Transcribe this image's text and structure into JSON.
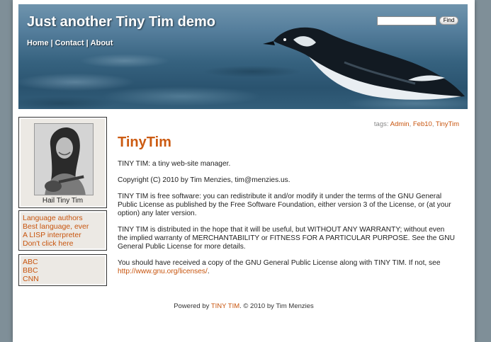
{
  "header": {
    "site_title": "Just another Tiny Tim demo",
    "nav": [
      "Home",
      "Contact",
      "About"
    ],
    "nav_separator": "|",
    "search_placeholder": "",
    "search_button": "Find"
  },
  "sidebar": {
    "photo_caption": "Hail Tiny Tim",
    "links_group1": [
      "Language authors",
      "Best language, ever",
      "A LISP interpreter",
      "Don't click here"
    ],
    "links_group2": [
      "ABC",
      "BBC",
      "CNN"
    ]
  },
  "post": {
    "tags_label": "tags:",
    "tags": [
      "Admin",
      "Feb10",
      "TinyTim"
    ],
    "title": "TinyTim",
    "paragraphs": [
      "TINY TIM: a tiny web-site manager.",
      "Copyright (C) 2010 by Tim Menzies, tim@menzies.us.",
      "TINY TIM is free software: you can redistribute it and/or modify it under the terms of the GNU General Public License as published by the Free Software Foundation, either version 3 of the License, or (at your option) any later version.",
      "TINY TIM is distributed in the hope that it will be useful, but WITHOUT ANY WARRANTY; without even the implied warranty of MERCHANTABILITY or FITNESS FOR A PARTICULAR PURPOSE. See the GNU General Public License for more details."
    ],
    "last_paragraph_prefix": "You should have received a copy of the GNU General Public License along with TINY TIM. If not, see ",
    "license_link": "http://www.gnu.org/licenses/",
    "last_paragraph_suffix": "."
  },
  "footer": {
    "prefix": "Powered by ",
    "link": "TINY TIM",
    "suffix": ". © 2010 by Tim Menzies"
  },
  "colors": {
    "accent": "#cc5b12",
    "link": "#c8550e",
    "sidebar_bg": "#ece9e4",
    "page_bg": "#7f8f98"
  }
}
